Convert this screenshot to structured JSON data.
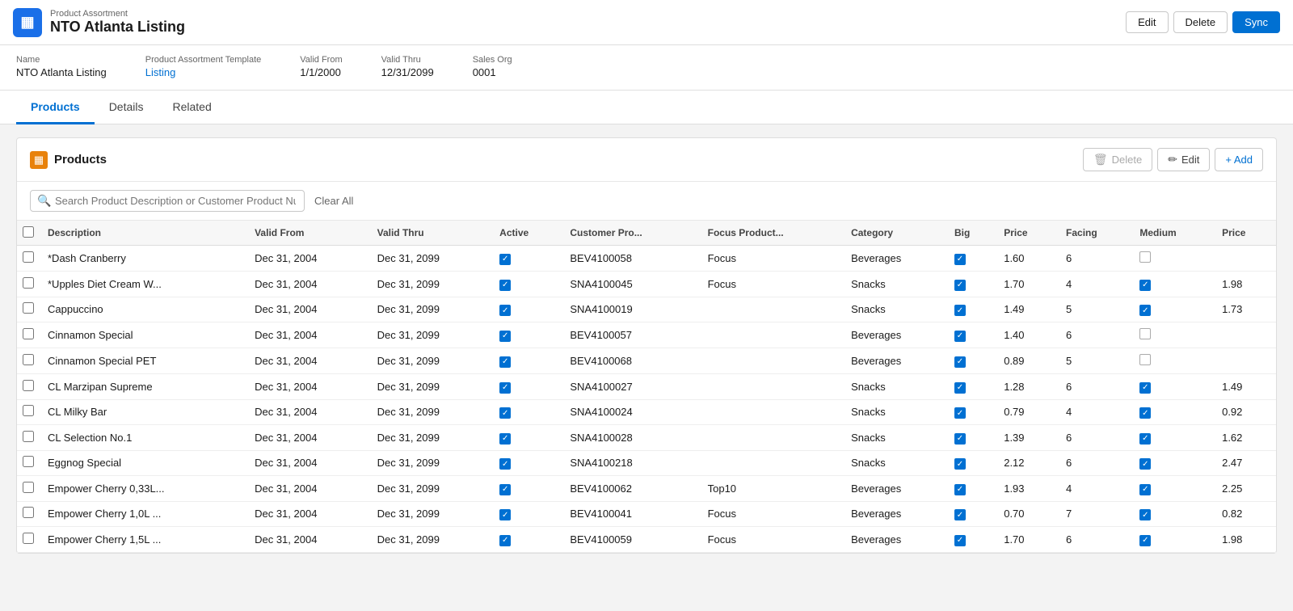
{
  "header": {
    "subtitle": "Product Assortment",
    "title": "NTO Atlanta Listing",
    "icon": "▦",
    "actions": {
      "edit": "Edit",
      "delete": "Delete",
      "sync": "Sync"
    }
  },
  "info": {
    "fields": [
      {
        "label": "Name",
        "value": "NTO Atlanta Listing",
        "isLink": false
      },
      {
        "label": "Product Assortment Template",
        "value": "Listing",
        "isLink": true
      },
      {
        "label": "Valid From",
        "value": "1/1/2000",
        "isLink": false
      },
      {
        "label": "Valid Thru",
        "value": "12/31/2099",
        "isLink": false
      },
      {
        "label": "Sales Org",
        "value": "0001",
        "isLink": false
      }
    ]
  },
  "tabs": [
    {
      "label": "Products",
      "active": true
    },
    {
      "label": "Details",
      "active": false
    },
    {
      "label": "Related",
      "active": false
    }
  ],
  "products_section": {
    "title": "Products",
    "icon": "▦",
    "actions": {
      "delete": "Delete",
      "edit": "Edit",
      "add": "+ Add"
    },
    "search": {
      "placeholder": "Search Product Description or Customer Product Number.",
      "clear_label": "Clear All"
    },
    "table": {
      "columns": [
        "Description",
        "Valid From",
        "Valid Thru",
        "Active",
        "Customer Pro...",
        "Focus Product...",
        "Category",
        "Big",
        "Price",
        "Facing",
        "Medium",
        "Price"
      ],
      "rows": [
        {
          "description": "*Dash Cranberry",
          "validFrom": "Dec 31, 2004",
          "validThru": "Dec 31, 2099",
          "active": true,
          "customerPro": "BEV4100058",
          "focusProduct": "Focus",
          "category": "Beverages",
          "big": true,
          "price": "1.60",
          "facing": "6",
          "medium": false,
          "price2": ""
        },
        {
          "description": "*Upples Diet Cream W...",
          "validFrom": "Dec 31, 2004",
          "validThru": "Dec 31, 2099",
          "active": true,
          "customerPro": "SNA4100045",
          "focusProduct": "Focus",
          "category": "Snacks",
          "big": true,
          "price": "1.70",
          "facing": "4",
          "medium": true,
          "price2": "1.98"
        },
        {
          "description": "Cappuccino",
          "validFrom": "Dec 31, 2004",
          "validThru": "Dec 31, 2099",
          "active": true,
          "customerPro": "SNA4100019",
          "focusProduct": "",
          "category": "Snacks",
          "big": true,
          "price": "1.49",
          "facing": "5",
          "medium": true,
          "price2": "1.73"
        },
        {
          "description": "Cinnamon Special",
          "validFrom": "Dec 31, 2004",
          "validThru": "Dec 31, 2099",
          "active": true,
          "customerPro": "BEV4100057",
          "focusProduct": "",
          "category": "Beverages",
          "big": true,
          "price": "1.40",
          "facing": "6",
          "medium": false,
          "price2": ""
        },
        {
          "description": "Cinnamon Special PET",
          "validFrom": "Dec 31, 2004",
          "validThru": "Dec 31, 2099",
          "active": true,
          "customerPro": "BEV4100068",
          "focusProduct": "",
          "category": "Beverages",
          "big": true,
          "price": "0.89",
          "facing": "5",
          "medium": false,
          "price2": ""
        },
        {
          "description": "CL Marzipan Supreme",
          "validFrom": "Dec 31, 2004",
          "validThru": "Dec 31, 2099",
          "active": true,
          "customerPro": "SNA4100027",
          "focusProduct": "",
          "category": "Snacks",
          "big": true,
          "price": "1.28",
          "facing": "6",
          "medium": true,
          "price2": "1.49"
        },
        {
          "description": "CL Milky Bar",
          "validFrom": "Dec 31, 2004",
          "validThru": "Dec 31, 2099",
          "active": true,
          "customerPro": "SNA4100024",
          "focusProduct": "",
          "category": "Snacks",
          "big": true,
          "price": "0.79",
          "facing": "4",
          "medium": true,
          "price2": "0.92"
        },
        {
          "description": "CL Selection No.1",
          "validFrom": "Dec 31, 2004",
          "validThru": "Dec 31, 2099",
          "active": true,
          "customerPro": "SNA4100028",
          "focusProduct": "",
          "category": "Snacks",
          "big": true,
          "price": "1.39",
          "facing": "6",
          "medium": true,
          "price2": "1.62"
        },
        {
          "description": "Eggnog Special",
          "validFrom": "Dec 31, 2004",
          "validThru": "Dec 31, 2099",
          "active": true,
          "customerPro": "SNA4100218",
          "focusProduct": "",
          "category": "Snacks",
          "big": true,
          "price": "2.12",
          "facing": "6",
          "medium": true,
          "price2": "2.47"
        },
        {
          "description": "Empower Cherry 0,33L...",
          "validFrom": "Dec 31, 2004",
          "validThru": "Dec 31, 2099",
          "active": true,
          "customerPro": "BEV4100062",
          "focusProduct": "Top10",
          "category": "Beverages",
          "big": true,
          "price": "1.93",
          "facing": "4",
          "medium": true,
          "price2": "2.25"
        },
        {
          "description": "Empower Cherry 1,0L ...",
          "validFrom": "Dec 31, 2004",
          "validThru": "Dec 31, 2099",
          "active": true,
          "customerPro": "BEV4100041",
          "focusProduct": "Focus",
          "category": "Beverages",
          "big": true,
          "price": "0.70",
          "facing": "7",
          "medium": true,
          "price2": "0.82"
        },
        {
          "description": "Empower Cherry 1,5L ...",
          "validFrom": "Dec 31, 2004",
          "validThru": "Dec 31, 2099",
          "active": true,
          "customerPro": "BEV4100059",
          "focusProduct": "Focus",
          "category": "Beverages",
          "big": true,
          "price": "1.70",
          "facing": "6",
          "medium": true,
          "price2": "1.98"
        }
      ]
    }
  }
}
